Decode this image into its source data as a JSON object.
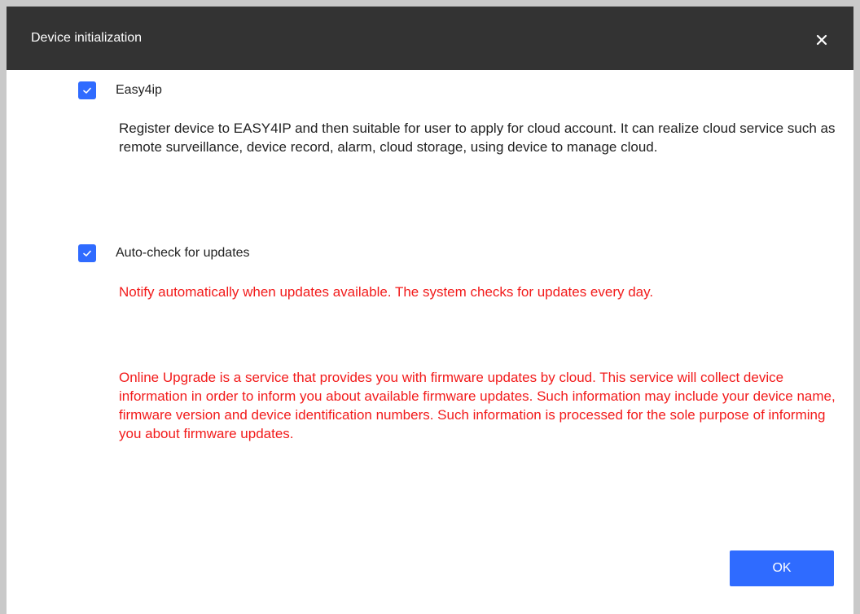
{
  "dialog": {
    "title": "Device initialization"
  },
  "options": [
    {
      "label": "Easy4ip",
      "checked": true,
      "description": "Register device to EASY4IP and then suitable for user to apply for cloud account. It can realize cloud service such as remote surveillance, device record, alarm, cloud storage, using device to manage cloud."
    },
    {
      "label": "Auto-check for updates",
      "checked": true,
      "description": "Notify automatically when updates available. The system checks for updates every day."
    }
  ],
  "online_upgrade_notice": "Online Upgrade is a service that provides you with firmware updates by cloud. This service will collect device information in order to inform you about available firmware updates. Such information may include your device name, firmware version and device identification numbers. Such information is processed for the sole purpose of informing you about firmware updates.",
  "buttons": {
    "ok_label": "OK"
  },
  "colors": {
    "titlebar": "#333333",
    "accent": "#2f6bff",
    "warning_text": "#f21b1b"
  },
  "icons": {
    "close": "close-icon",
    "check": "checkmark-icon"
  }
}
